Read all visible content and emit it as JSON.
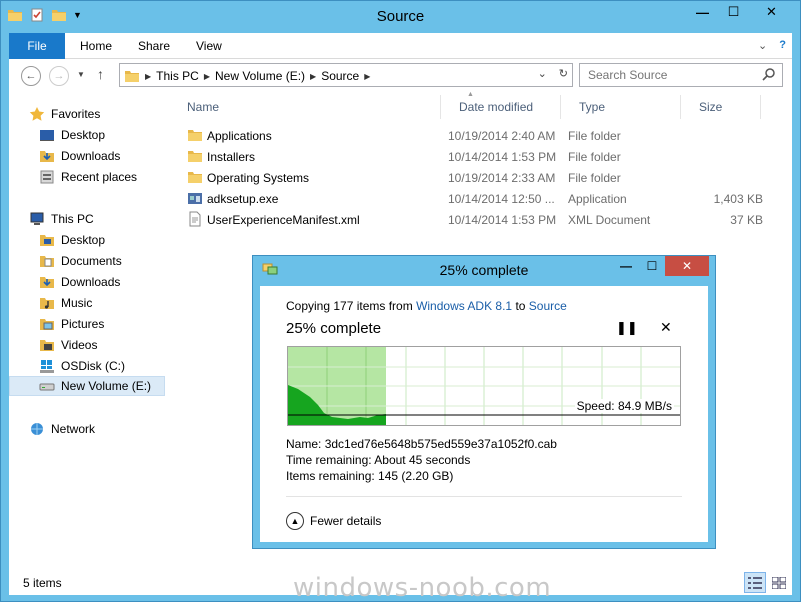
{
  "window": {
    "title": "Source",
    "controls": {
      "minimize": "—",
      "maximize": "☐",
      "close": "✕"
    }
  },
  "ribbon": {
    "tabs": [
      {
        "label": "File"
      },
      {
        "label": "Home"
      },
      {
        "label": "Share"
      },
      {
        "label": "View"
      }
    ]
  },
  "address": {
    "crumbs": [
      "This PC",
      "New Volume (E:)",
      "Source"
    ]
  },
  "search": {
    "placeholder": "Search Source"
  },
  "nav": {
    "favorites": "Favorites",
    "fav_items": [
      "Desktop",
      "Downloads",
      "Recent places"
    ],
    "this_pc": "This PC",
    "pc_items": [
      "Desktop",
      "Documents",
      "Downloads",
      "Music",
      "Pictures",
      "Videos",
      "OSDisk (C:)",
      "New Volume (E:)"
    ],
    "network": "Network"
  },
  "files": {
    "columns": [
      "Name",
      "Date modified",
      "Type",
      "Size"
    ],
    "rows": [
      {
        "name": "Applications",
        "date": "10/19/2014 2:40 AM",
        "type": "File folder",
        "size": "",
        "icon": "folder-icon"
      },
      {
        "name": "Installers",
        "date": "10/14/2014 1:53 PM",
        "type": "File folder",
        "size": "",
        "icon": "folder-icon"
      },
      {
        "name": "Operating Systems",
        "date": "10/19/2014 2:33 AM",
        "type": "File folder",
        "size": "",
        "icon": "folder-icon"
      },
      {
        "name": "adksetup.exe",
        "date": "10/14/2014 12:50 ...",
        "type": "Application",
        "size": "1,403 KB",
        "icon": "exe-icon"
      },
      {
        "name": "UserExperienceManifest.xml",
        "date": "10/14/2014 1:53 PM",
        "type": "XML Document",
        "size": "37 KB",
        "icon": "xml-file-icon"
      }
    ]
  },
  "status": {
    "item_count": "5 items"
  },
  "watermark": "windows-noob.com",
  "dialog": {
    "title": "25% complete",
    "copying_prefix": "Copying 177 items from ",
    "source_link": "Windows ADK 8.1",
    "to_word": " to ",
    "dest_link": "Source",
    "percent_label": "25% complete",
    "progress_fraction": 0.25,
    "speed_label": "Speed: 84.9 MB/s",
    "name_label": "Name:",
    "name_value": "3dc1ed76e5648b575ed559e37a1052f0.cab",
    "time_label": "Time remaining:",
    "time_value": "About 45 seconds",
    "items_label": "Items remaining:",
    "items_value": "145 (2.20 GB)",
    "fewer_details": "Fewer details",
    "pause_glyph": "❚❚",
    "close_glyph": "✕"
  },
  "colors": {
    "title_bg": "#6ac0e8",
    "accent": "#1979ca",
    "progress_green": "#b5e6a3",
    "graph_green": "#16a51f"
  }
}
